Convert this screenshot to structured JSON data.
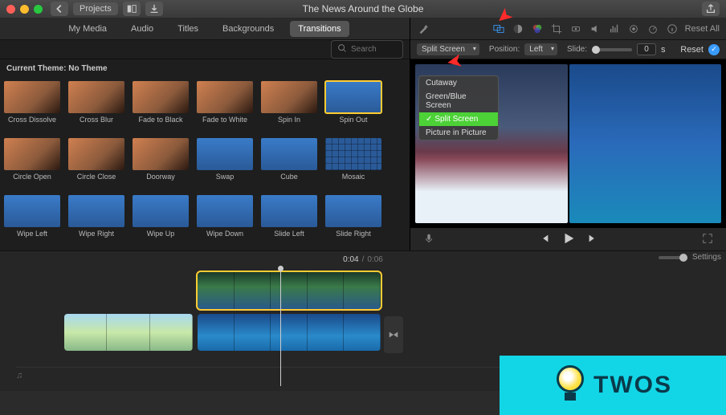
{
  "window": {
    "title": "The News Around the Globe"
  },
  "nav": {
    "back_label": "Projects"
  },
  "tabs": {
    "items": [
      "My Media",
      "Audio",
      "Titles",
      "Backgrounds",
      "Transitions"
    ],
    "active": "Transitions"
  },
  "search": {
    "placeholder": "Search"
  },
  "theme": {
    "label": "Current Theme: No Theme"
  },
  "transitions": [
    {
      "label": "Cross Dissolve",
      "style": ""
    },
    {
      "label": "Cross Blur",
      "style": ""
    },
    {
      "label": "Fade to Black",
      "style": ""
    },
    {
      "label": "Fade to White",
      "style": ""
    },
    {
      "label": "Spin In",
      "style": ""
    },
    {
      "label": "Spin Out",
      "style": "sky",
      "selected": true
    },
    {
      "label": "Circle Open",
      "style": ""
    },
    {
      "label": "Circle Close",
      "style": ""
    },
    {
      "label": "Doorway",
      "style": ""
    },
    {
      "label": "Swap",
      "style": "sky"
    },
    {
      "label": "Cube",
      "style": "sky"
    },
    {
      "label": "Mosaic",
      "style": "mosaic"
    },
    {
      "label": "Wipe Left",
      "style": "sky"
    },
    {
      "label": "Wipe Right",
      "style": "sky"
    },
    {
      "label": "Wipe Up",
      "style": "sky"
    },
    {
      "label": "Wipe Down",
      "style": "sky"
    },
    {
      "label": "Slide Left",
      "style": "sky"
    },
    {
      "label": "Slide Right",
      "style": "sky"
    }
  ],
  "viewer_toolbar": {
    "reset_all": "Reset All"
  },
  "controls": {
    "mode": "Split Screen",
    "position_label": "Position:",
    "position_value": "Left",
    "slide_label": "Slide:",
    "slide_value": "0",
    "slide_unit": "s",
    "reset_label": "Reset"
  },
  "overlay_menu": {
    "items": [
      "Cutaway",
      "Green/Blue Screen",
      "Split Screen",
      "Picture in Picture"
    ],
    "selected": "Split Screen"
  },
  "playback": {
    "current": "0:04",
    "total": "0:06"
  },
  "timeline": {
    "settings_label": "Settings"
  },
  "logo": {
    "text": "TWOS"
  }
}
